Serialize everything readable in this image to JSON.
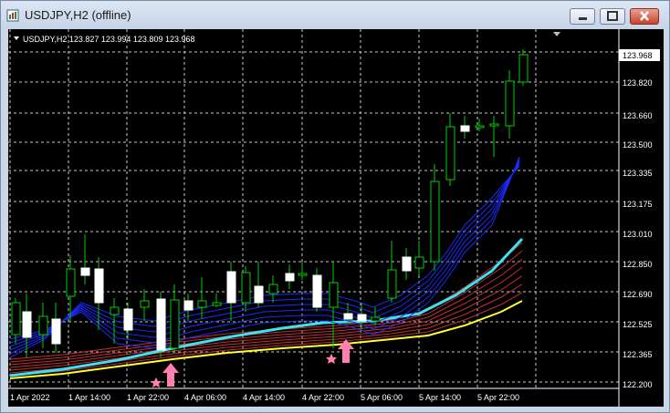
{
  "window": {
    "title": "USDJPY,H2 (offline)"
  },
  "chart": {
    "info_line": "USDJPY,H2  123.827 123.994 123.809 123.968",
    "price_labels": [
      "123.820",
      "123.660",
      "123.500",
      "123.335",
      "123.175",
      "123.010",
      "122.850",
      "122.690",
      "122.525",
      "122.365",
      "122.200"
    ],
    "current_price": "123.968",
    "time_labels": [
      "1 Apr 2022",
      "1 Apr 14:00",
      "1 Apr 22:00",
      "4 Apr 06:00",
      "4 Apr 14:00",
      "4 Apr 22:00",
      "5 Apr 06:00",
      "5 Apr 14:00",
      "5 Apr 22:00"
    ]
  },
  "colors": {
    "bull": "#ffffff",
    "bear_outline": "#00d000",
    "grid": "#c8c8c8",
    "ma_fast": "#1a2cff",
    "ma_cyan": "#40e0f0",
    "ma_red": "#c03030",
    "ma_yellow": "#ffff30",
    "arrow": "#ff7fb0"
  },
  "icons": {
    "app": "chart-window-icon",
    "minimize": "minimize-icon",
    "maximize": "maximize-icon",
    "close": "close-icon",
    "dropdown": "triangle-down-icon"
  }
}
